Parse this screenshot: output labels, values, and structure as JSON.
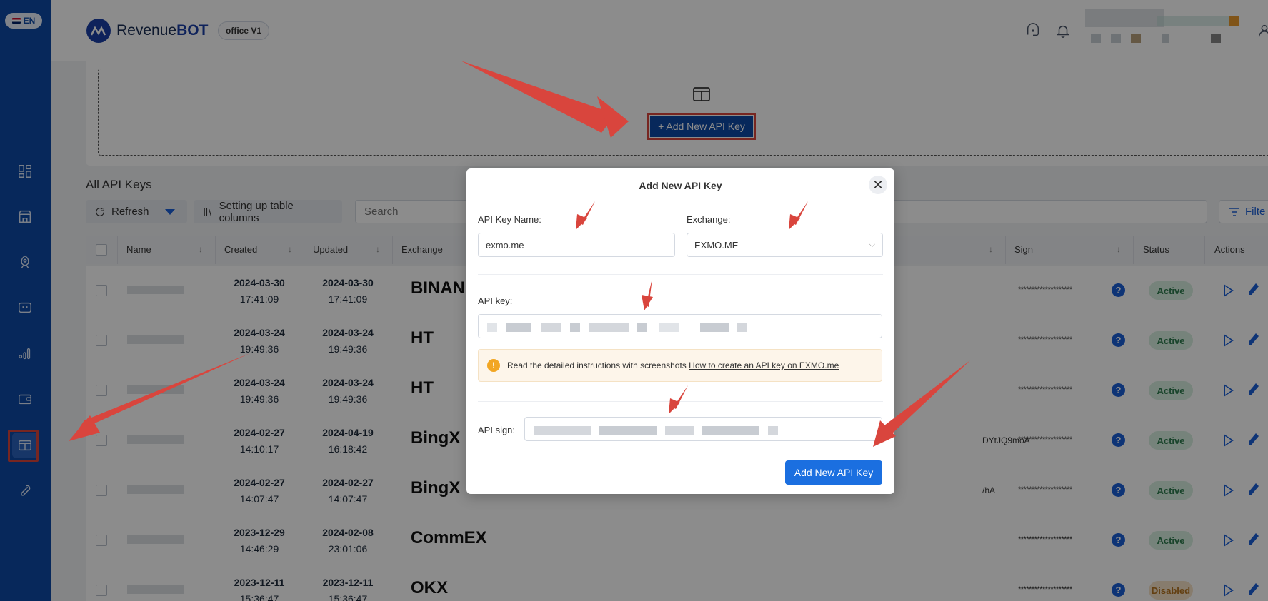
{
  "sidebar": {
    "lang": "EN",
    "nav": [
      {
        "name": "dashboard-icon"
      },
      {
        "name": "store-icon"
      },
      {
        "name": "rocket-icon"
      },
      {
        "name": "bot-icon"
      },
      {
        "name": "chart-icon"
      },
      {
        "name": "wallet-icon"
      },
      {
        "name": "api-keys-icon"
      },
      {
        "name": "wrench-icon"
      }
    ]
  },
  "header": {
    "brand_prefix": "Revenue",
    "brand_suffix": "BOT",
    "office": "office V1"
  },
  "upload": {
    "add_button": "+ Add New API Key"
  },
  "table": {
    "title": "All API Keys",
    "refresh": "Refresh",
    "columns_btn": "Setting up table columns",
    "search_placeholder": "Search",
    "filter": "Filte",
    "headers": {
      "name": "Name",
      "created": "Created",
      "updated": "Updated",
      "exchange": "Exchange",
      "sign": "Sign",
      "status": "Status",
      "actions": "Actions"
    },
    "rows": [
      {
        "created_d": "2024-03-30",
        "created_t": "17:41:09",
        "updated_d": "2024-03-30",
        "updated_t": "17:41:09",
        "exchange": "BINAN",
        "key": "",
        "sign": "********************",
        "status": "Active"
      },
      {
        "created_d": "2024-03-24",
        "created_t": "19:49:36",
        "updated_d": "2024-03-24",
        "updated_t": "19:49:36",
        "exchange": "HT",
        "key": "",
        "sign": "********************",
        "status": "Active"
      },
      {
        "created_d": "2024-03-24",
        "created_t": "19:49:36",
        "updated_d": "2024-03-24",
        "updated_t": "19:49:36",
        "exchange": "HT",
        "key": "",
        "sign": "********************",
        "status": "Active"
      },
      {
        "created_d": "2024-02-27",
        "created_t": "14:10:17",
        "updated_d": "2024-04-19",
        "updated_t": "16:18:42",
        "exchange": "BingX",
        "key": "DYtJQ9moA",
        "sign": "********************",
        "status": "Active"
      },
      {
        "created_d": "2024-02-27",
        "created_t": "14:07:47",
        "updated_d": "2024-02-27",
        "updated_t": "14:07:47",
        "exchange": "BingX",
        "key": "/hA",
        "sign": "********************",
        "status": "Active"
      },
      {
        "created_d": "2023-12-29",
        "created_t": "14:46:29",
        "updated_d": "2024-02-08",
        "updated_t": "23:01:06",
        "exchange": "CommEX",
        "key": "",
        "sign": "********************",
        "status": "Active"
      },
      {
        "created_d": "2023-12-11",
        "created_t": "15:36:47",
        "updated_d": "2023-12-11",
        "updated_t": "15:36:47",
        "exchange": "OKX",
        "key": "",
        "sign": "********************",
        "status": "Disabled"
      }
    ]
  },
  "modal": {
    "title": "Add New API Key",
    "close": "✕",
    "name_label": "API Key Name:",
    "name_value": "exmo.me",
    "exchange_label": "Exchange:",
    "exchange_value": "EXMO.ME",
    "key_label": "API key:",
    "warning_text": "Read the detailed instructions with screenshots",
    "warning_link": "How to create an API key on EXMO.me",
    "sign_label": "API sign:",
    "submit": "Add New API Key"
  },
  "colors": {
    "sidebar": "#0d4aa6",
    "primary": "#1b6fe0",
    "annotation": "#d9453d"
  }
}
